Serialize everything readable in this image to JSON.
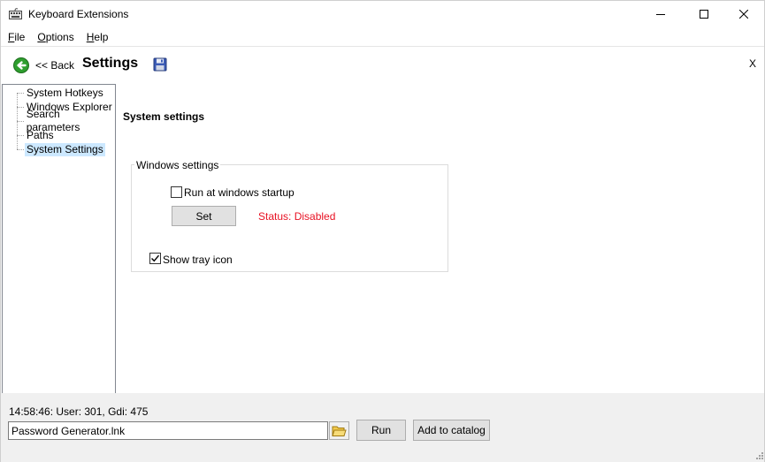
{
  "window": {
    "title": "Keyboard Extensions",
    "controls": {
      "minimize": "minimize",
      "maximize": "maximize",
      "close": "close"
    }
  },
  "menu": [
    {
      "label": "File",
      "underline": "F",
      "rest": "ile"
    },
    {
      "label": "Options",
      "underline": "O",
      "rest": "ptions"
    },
    {
      "label": "Help",
      "underline": "H",
      "rest": "elp"
    }
  ],
  "header": {
    "back_label": "<< Back",
    "title": "Settings",
    "close_label": "X",
    "icons": {
      "back": "green-back-arrow-icon",
      "save": "floppy-disk-icon"
    }
  },
  "tree": {
    "items": [
      {
        "label": "System Hotkeys",
        "selected": false
      },
      {
        "label": "Windows Explorer",
        "selected": false
      },
      {
        "label": "Search parameters",
        "selected": false
      },
      {
        "label": "Paths",
        "selected": false
      },
      {
        "label": "System Settings",
        "selected": true
      }
    ]
  },
  "content": {
    "section_title": "System settings",
    "group_title": "Windows settings",
    "run_at_startup": {
      "label": "Run at windows startup",
      "checked": false
    },
    "set_button": "Set",
    "status": "Status: Disabled",
    "show_tray": {
      "label": "Show tray icon",
      "checked": true
    }
  },
  "bottom": {
    "stats": "14:58:46: User: 301, Gdi: 475",
    "command_value": "Password Generator.lnk",
    "run_button": "Run",
    "catalog_button": "Add to catalog"
  },
  "colors": {
    "status_text": "#e81123",
    "selection": "#cce8ff",
    "panel": "#f0f0f0",
    "button": "#e1e1e1"
  }
}
